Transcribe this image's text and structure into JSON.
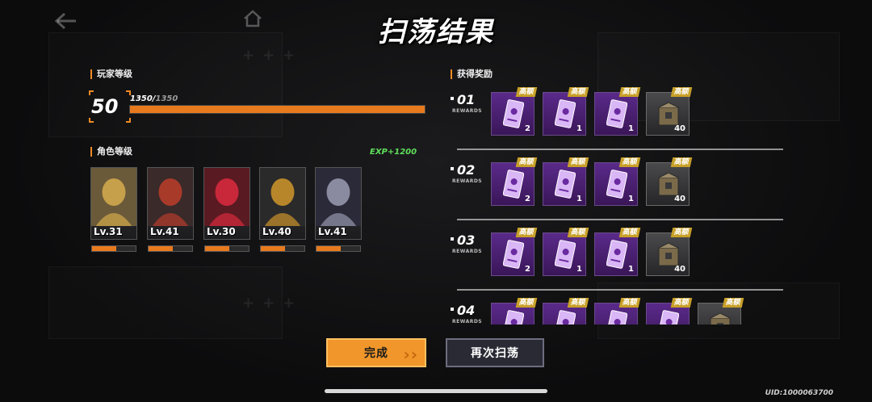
{
  "header": {
    "title": "扫荡结果"
  },
  "player_level": {
    "label": "玩家等级",
    "level": "50",
    "exp_current": "1350",
    "exp_max": "1350",
    "progress": 1.0
  },
  "character_level": {
    "label": "角色等级",
    "exp_gain": "EXP+1200",
    "characters": [
      {
        "level": "Lv.31",
        "progress": 0.55,
        "palette": [
          "#c6a04a",
          "#6a5a3a"
        ]
      },
      {
        "level": "Lv.41",
        "progress": 0.55,
        "palette": [
          "#a83a2a",
          "#3a2a2a"
        ]
      },
      {
        "level": "Lv.30",
        "progress": 0.55,
        "palette": [
          "#c8283a",
          "#5a1a22"
        ]
      },
      {
        "level": "Lv.40",
        "progress": 0.55,
        "palette": [
          "#b8862a",
          "#2a2a2a"
        ]
      },
      {
        "level": "Lv.41",
        "progress": 0.55,
        "palette": [
          "#8a8aa0",
          "#2a2a38"
        ]
      }
    ]
  },
  "rewards": {
    "label": "获得奖励",
    "row_sub": "REWARDS",
    "badge": "高额",
    "rows": [
      {
        "num": "01",
        "items": [
          {
            "kind": "ticket",
            "count": "2"
          },
          {
            "kind": "ticket",
            "count": "1"
          },
          {
            "kind": "ticket",
            "count": "1"
          },
          {
            "kind": "box",
            "count": "40"
          }
        ]
      },
      {
        "num": "02",
        "items": [
          {
            "kind": "ticket",
            "count": "2"
          },
          {
            "kind": "ticket",
            "count": "1"
          },
          {
            "kind": "ticket",
            "count": "1"
          },
          {
            "kind": "box",
            "count": "40"
          }
        ]
      },
      {
        "num": "03",
        "items": [
          {
            "kind": "ticket",
            "count": "2"
          },
          {
            "kind": "ticket",
            "count": "1"
          },
          {
            "kind": "ticket",
            "count": "1"
          },
          {
            "kind": "box",
            "count": "40"
          }
        ]
      },
      {
        "num": "04",
        "items": [
          {
            "kind": "ticket",
            "count": ""
          },
          {
            "kind": "ticket",
            "count": ""
          },
          {
            "kind": "ticket",
            "count": ""
          },
          {
            "kind": "ticket",
            "count": ""
          },
          {
            "kind": "box",
            "count": ""
          }
        ]
      }
    ]
  },
  "buttons": {
    "done_label": "完成",
    "again_label": "再次扫荡"
  },
  "footer": {
    "uid": "UID:1000063700"
  },
  "colors": {
    "accent": "#f08a24",
    "exp_gain": "#5ee05a",
    "item_purple": "#5a2a8a"
  }
}
